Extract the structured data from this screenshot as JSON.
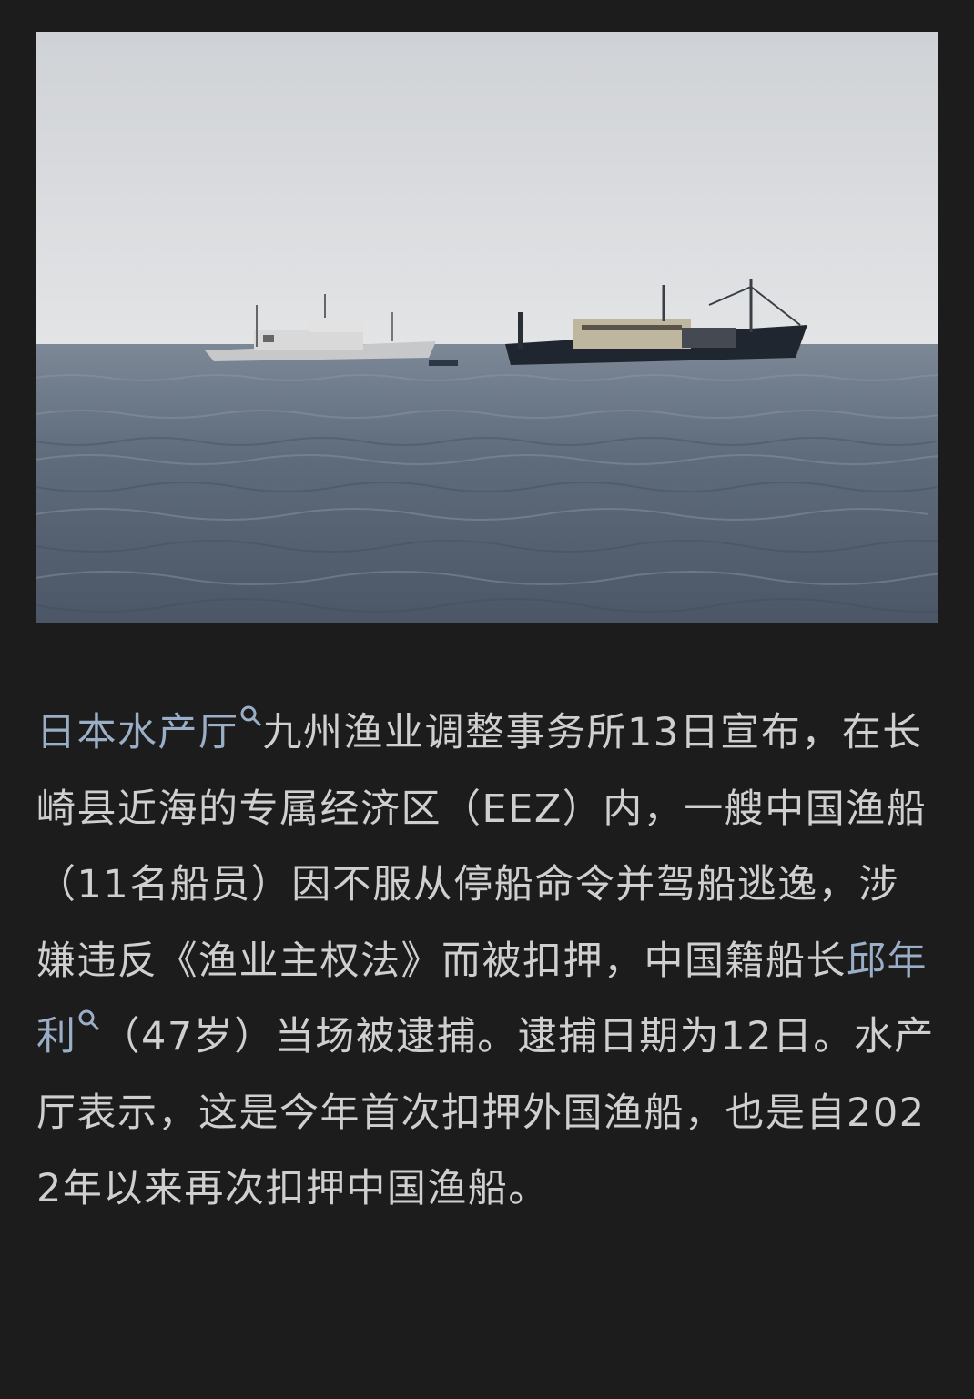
{
  "article": {
    "link1": "日本水产厅",
    "seg1": "九州渔业调整事务所13日宣布，在长崎县近海的专属经济区（EEZ）内，一艘中国渔船（11名船员）因不服从停船命令并驾船逃逸，涉嫌违反《渔业主权法》而被扣押，中国籍船长",
    "link2": "邱年利",
    "seg2": "（47岁）当场被逮捕。逮捕日期为12日。水产厅表示，这是今年首次扣押外国渔船，也是自2022年以来再次扣押中国渔船。"
  },
  "icons": [
    "search-icon"
  ],
  "colors": {
    "background": "#1c1c1c",
    "text": "#cfcfcf",
    "link": "#9aaec8"
  }
}
